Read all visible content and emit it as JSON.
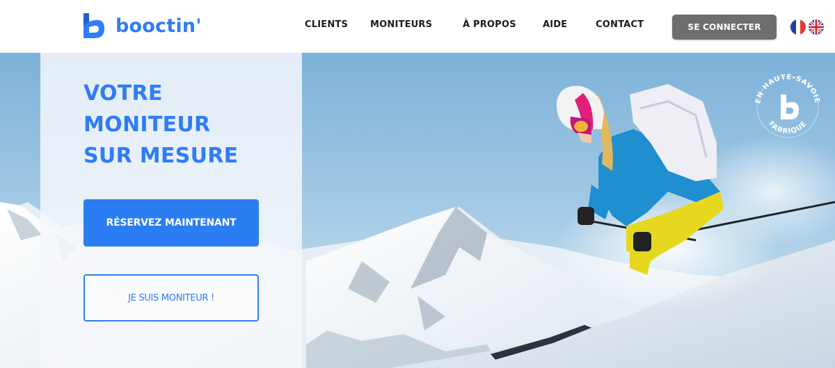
{
  "colors": {
    "brand_blue": "#2f7cf6",
    "cta_blue": "#2b7df2",
    "login_gray": "#6e6e6e",
    "text_dark": "#1a1a1a"
  },
  "header": {
    "brand_name": "booctin'",
    "logo_icon": "booctin-b-logo-icon",
    "nav": [
      "CLIENTS",
      "MONITEURS",
      "À PROPOS",
      "AIDE",
      "CONTACT"
    ],
    "login_label": "SE CONNECTER",
    "languages": [
      {
        "code": "fr",
        "icon": "france-flag-icon"
      },
      {
        "code": "en",
        "icon": "uk-flag-icon"
      }
    ]
  },
  "hero": {
    "headline": [
      "VOTRE",
      "MONITEUR",
      "SUR MESURE"
    ],
    "primary_cta": "RÉSERVEZ MAINTENANT",
    "secondary_cta": "JE SUIS MONITEUR !",
    "badge": {
      "text_top": "EN HAUTE-SAVOIE",
      "text_bottom": "FABRIQUE",
      "icon": "booctin-b-badge-icon"
    },
    "background": "skier-mountain-photo"
  }
}
